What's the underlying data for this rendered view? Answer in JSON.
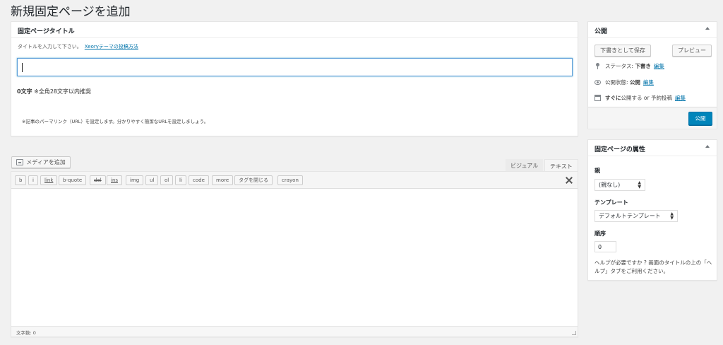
{
  "page_title": "新規固定ページを追加",
  "title_box": {
    "heading": "固定ページタイトル",
    "hint": "タイトルを入力して下さい。",
    "hint_link": "Xeoryテーマの投稿方法",
    "title_value": "",
    "count_number": "0文字",
    "count_note": "※全角28文字以内推奨",
    "permalink_note": "※記事のパーマリンク（URL）を設定します。分かりやすく簡潔なURLを設定しましょう。"
  },
  "editor": {
    "media_button": "メディアを追加",
    "tab_visual": "ビジュアル",
    "tab_text": "テキスト",
    "quicktags": [
      "b",
      "i",
      "link",
      "b-quote",
      "del",
      "ins",
      "img",
      "ul",
      "ol",
      "li",
      "code",
      "more",
      "タグを閉じる",
      "crayon"
    ],
    "word_count": "文字数: 0"
  },
  "publish": {
    "heading": "公開",
    "save_draft": "下書きとして保存",
    "preview": "プレビュー",
    "status_label": "ステータス:",
    "status_value": "下書き",
    "visibility_label": "公開状態:",
    "visibility_value": "公開",
    "schedule_immediately": "すぐに",
    "schedule_text": "公開する or 予約投稿",
    "edit": "編集",
    "publish_button": "公開"
  },
  "attributes": {
    "heading": "固定ページの属性",
    "parent_label": "親",
    "parent_value": "(親なし)",
    "template_label": "テンプレート",
    "template_value": "デフォルトテンプレート",
    "order_label": "順序",
    "order_value": "0",
    "help_text": "ヘルプが必要ですか ? 画面のタイトルの上の「ヘルプ」タブをご利用ください。"
  },
  "icons": [
    "media-icon",
    "pin-icon",
    "eye-icon",
    "calendar-icon",
    "fullscreen-icon"
  ],
  "colors": {
    "primary": "#0085ba",
    "link": "#0073aa",
    "background": "#f1f1f1"
  }
}
